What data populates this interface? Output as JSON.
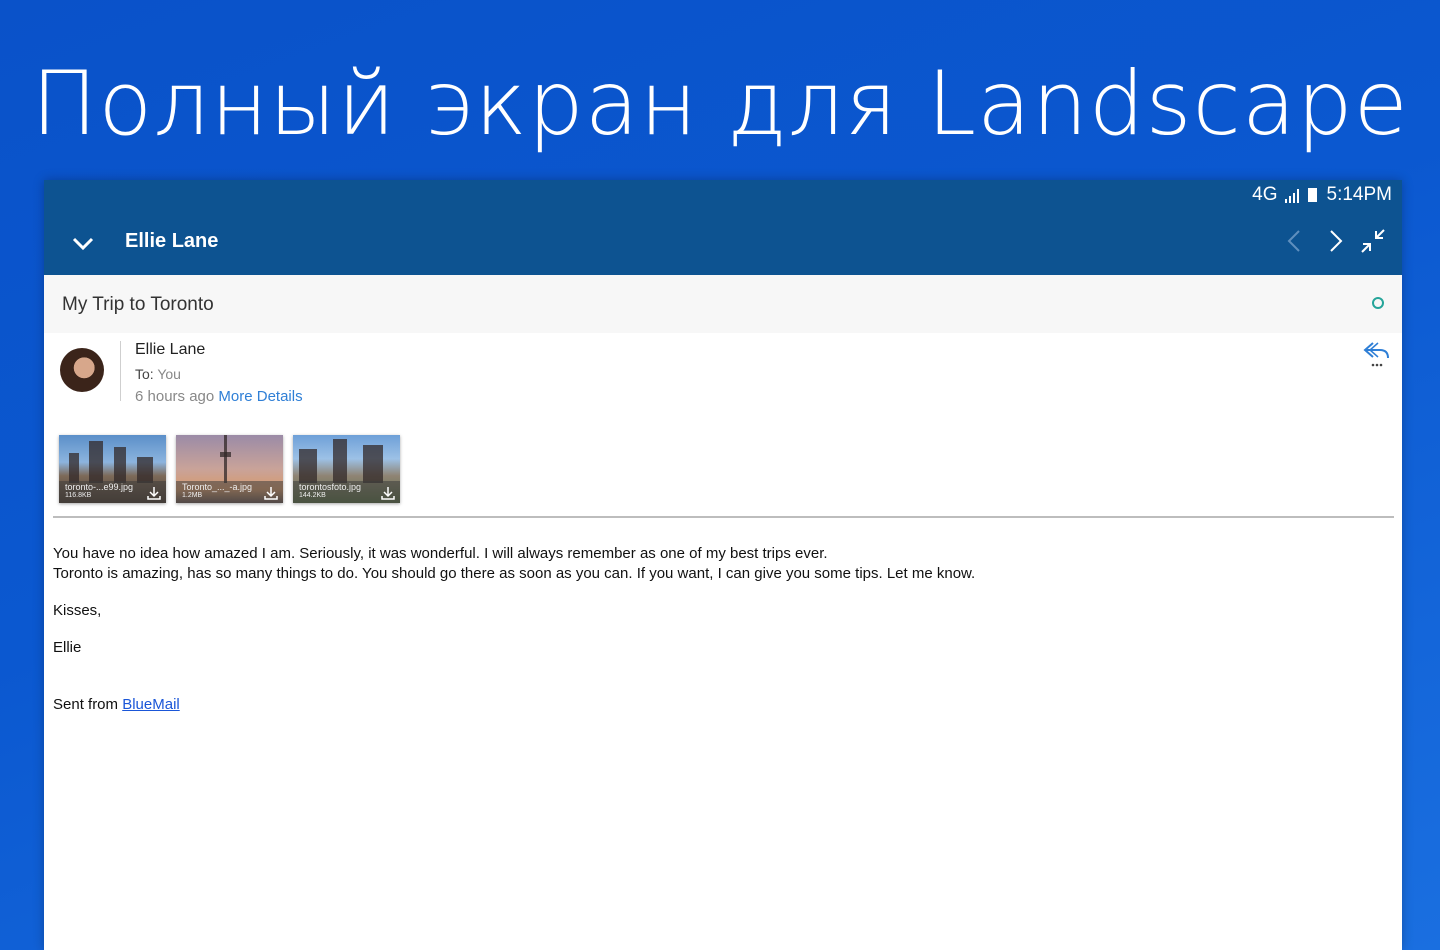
{
  "promo": {
    "title": "Полный экран для Landscape"
  },
  "status_bar": {
    "network": "4G",
    "time": "5:14PM"
  },
  "app_bar": {
    "title": "Ellie Lane"
  },
  "email": {
    "subject": "My Trip to Toronto",
    "sender": "Ellie Lane",
    "to_label": "To:",
    "to_value": "You",
    "time_ago": "6 hours ago",
    "more_details": "More Details",
    "attachments": [
      {
        "name": "toronto-...e99.jpg",
        "size": "116.8KB"
      },
      {
        "name": "Toronto_..._-a.jpg",
        "size": "1.2MB"
      },
      {
        "name": "torontosfoto.jpg",
        "size": "144.2KB"
      }
    ],
    "body": {
      "line1": "You have no idea how amazed I am. Seriously, it was wonderful. I will always remember as one of my best trips ever.",
      "line2": "Toronto is amazing, has so many things to do. You should go there as soon as you can. If you want, I can give you some tips. Let me know.",
      "closing": "Kisses,",
      "signature": "Ellie",
      "sent_from": "Sent from",
      "app_link": "BlueMail"
    }
  },
  "colors": {
    "app_bar": "#0d5391",
    "accent_link": "#2f7fd6",
    "status_dot": "#26a59a",
    "background": "#0b58d0"
  }
}
